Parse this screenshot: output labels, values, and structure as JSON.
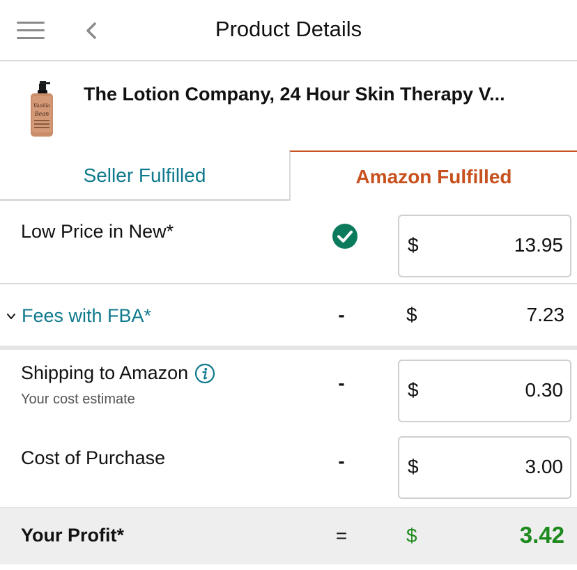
{
  "header": {
    "title": "Product Details",
    "menu_icon": "hamburger-menu-icon",
    "back_icon": "chevron-left-icon"
  },
  "product": {
    "title": "The Lotion Company, 24 Hour Skin Therapy V...",
    "image_label_line1": "Vanilla",
    "image_label_line2": "Bean"
  },
  "tabs": [
    {
      "label": "Seller Fulfilled",
      "active": false
    },
    {
      "label": "Amazon Fulfilled",
      "active": true
    }
  ],
  "rows": {
    "low_price": {
      "label": "Low Price in New*",
      "currency": "$",
      "value": "13.95",
      "status_icon": "check-circle-icon"
    },
    "fees": {
      "label": "Fees with FBA*",
      "operator": "-",
      "currency": "$",
      "value": "7.23",
      "toggle_icon": "chevron-down-icon"
    },
    "shipping": {
      "label": "Shipping to Amazon",
      "sublabel": "Your cost estimate",
      "operator": "-",
      "currency": "$",
      "value": "0.30",
      "info_icon": "info-icon"
    },
    "cost": {
      "label": "Cost of Purchase",
      "operator": "-",
      "currency": "$",
      "value": "3.00"
    },
    "profit": {
      "label": "Your Profit*",
      "operator": "=",
      "currency": "$",
      "value": "3.42"
    }
  },
  "colors": {
    "teal": "#0f7a8c",
    "amazon_orange": "#c7511f",
    "check_green": "#0c7a5c",
    "profit_green": "#1d8a1d"
  }
}
